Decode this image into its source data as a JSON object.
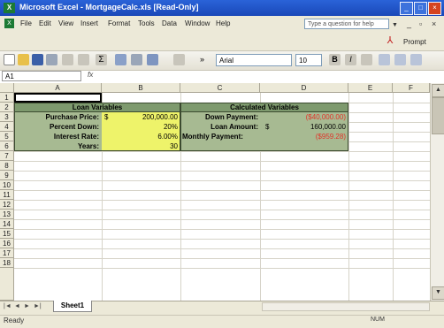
{
  "window": {
    "title": "Microsoft Excel - MortgageCalc.xls [Read-Only]"
  },
  "menu": [
    "File",
    "Edit",
    "View",
    "Insert",
    "Format",
    "Tools",
    "Data",
    "Window",
    "Help"
  ],
  "help_placeholder": "Type a question for help",
  "prompt_label": "Prompt",
  "toolbar": {
    "font": "Arial",
    "size": "10"
  },
  "namebox": "A1",
  "fx": "fx",
  "columns": [
    "A",
    "B",
    "C",
    "D",
    "E",
    "F"
  ],
  "rows": [
    "1",
    "2",
    "3",
    "4",
    "5",
    "6",
    "7",
    "8",
    "9",
    "10",
    "11",
    "12",
    "13",
    "14",
    "15",
    "16",
    "17",
    "18"
  ],
  "loan": {
    "header": "Loan Variables",
    "purchase_label": "Purchase Price:",
    "purchase_sym": "$",
    "purchase_val": "200,000.00",
    "percent_label": "Percent Down:",
    "percent_val": "20%",
    "rate_label": "Interest Rate:",
    "rate_val": "6.00%",
    "years_label": "Years:",
    "years_val": "30"
  },
  "calc": {
    "header": "Calculated Variables",
    "down_label": "Down Payment:",
    "down_val": "($40,000.00)",
    "loan_label": "Loan Amount:",
    "loan_sym": "$",
    "loan_val": "160,000.00",
    "monthly_label": "Monthly Payment:",
    "monthly_val": "($959.28)"
  },
  "sheet_tab": "Sheet1",
  "status": {
    "ready": "Ready",
    "num": "NUM"
  }
}
